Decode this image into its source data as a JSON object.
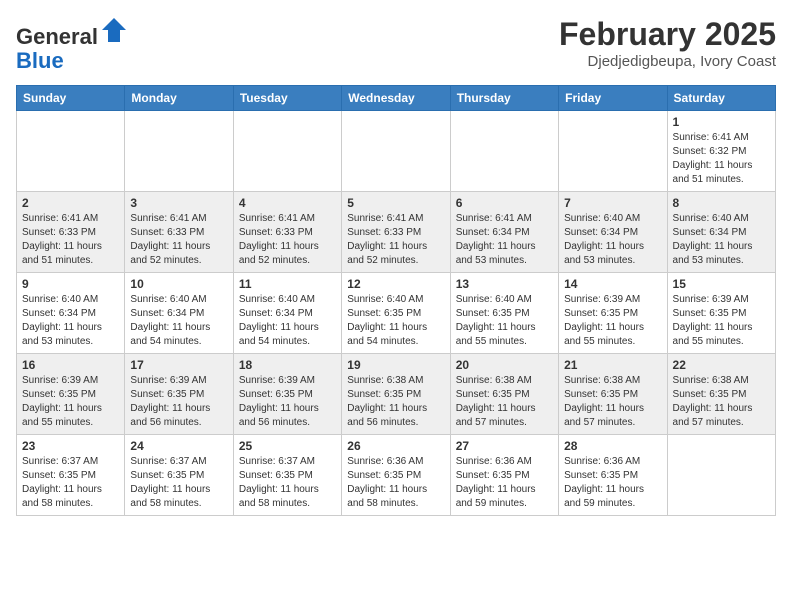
{
  "header": {
    "logo_general": "General",
    "logo_blue": "Blue",
    "month_title": "February 2025",
    "location": "Djedjedigbeupa, Ivory Coast"
  },
  "weekdays": [
    "Sunday",
    "Monday",
    "Tuesday",
    "Wednesday",
    "Thursday",
    "Friday",
    "Saturday"
  ],
  "weeks": [
    [
      {
        "day": "",
        "info": ""
      },
      {
        "day": "",
        "info": ""
      },
      {
        "day": "",
        "info": ""
      },
      {
        "day": "",
        "info": ""
      },
      {
        "day": "",
        "info": ""
      },
      {
        "day": "",
        "info": ""
      },
      {
        "day": "1",
        "info": "Sunrise: 6:41 AM\nSunset: 6:32 PM\nDaylight: 11 hours and 51 minutes."
      }
    ],
    [
      {
        "day": "2",
        "info": "Sunrise: 6:41 AM\nSunset: 6:33 PM\nDaylight: 11 hours and 51 minutes."
      },
      {
        "day": "3",
        "info": "Sunrise: 6:41 AM\nSunset: 6:33 PM\nDaylight: 11 hours and 52 minutes."
      },
      {
        "day": "4",
        "info": "Sunrise: 6:41 AM\nSunset: 6:33 PM\nDaylight: 11 hours and 52 minutes."
      },
      {
        "day": "5",
        "info": "Sunrise: 6:41 AM\nSunset: 6:33 PM\nDaylight: 11 hours and 52 minutes."
      },
      {
        "day": "6",
        "info": "Sunrise: 6:41 AM\nSunset: 6:34 PM\nDaylight: 11 hours and 53 minutes."
      },
      {
        "day": "7",
        "info": "Sunrise: 6:40 AM\nSunset: 6:34 PM\nDaylight: 11 hours and 53 minutes."
      },
      {
        "day": "8",
        "info": "Sunrise: 6:40 AM\nSunset: 6:34 PM\nDaylight: 11 hours and 53 minutes."
      }
    ],
    [
      {
        "day": "9",
        "info": "Sunrise: 6:40 AM\nSunset: 6:34 PM\nDaylight: 11 hours and 53 minutes."
      },
      {
        "day": "10",
        "info": "Sunrise: 6:40 AM\nSunset: 6:34 PM\nDaylight: 11 hours and 54 minutes."
      },
      {
        "day": "11",
        "info": "Sunrise: 6:40 AM\nSunset: 6:34 PM\nDaylight: 11 hours and 54 minutes."
      },
      {
        "day": "12",
        "info": "Sunrise: 6:40 AM\nSunset: 6:35 PM\nDaylight: 11 hours and 54 minutes."
      },
      {
        "day": "13",
        "info": "Sunrise: 6:40 AM\nSunset: 6:35 PM\nDaylight: 11 hours and 55 minutes."
      },
      {
        "day": "14",
        "info": "Sunrise: 6:39 AM\nSunset: 6:35 PM\nDaylight: 11 hours and 55 minutes."
      },
      {
        "day": "15",
        "info": "Sunrise: 6:39 AM\nSunset: 6:35 PM\nDaylight: 11 hours and 55 minutes."
      }
    ],
    [
      {
        "day": "16",
        "info": "Sunrise: 6:39 AM\nSunset: 6:35 PM\nDaylight: 11 hours and 55 minutes."
      },
      {
        "day": "17",
        "info": "Sunrise: 6:39 AM\nSunset: 6:35 PM\nDaylight: 11 hours and 56 minutes."
      },
      {
        "day": "18",
        "info": "Sunrise: 6:39 AM\nSunset: 6:35 PM\nDaylight: 11 hours and 56 minutes."
      },
      {
        "day": "19",
        "info": "Sunrise: 6:38 AM\nSunset: 6:35 PM\nDaylight: 11 hours and 56 minutes."
      },
      {
        "day": "20",
        "info": "Sunrise: 6:38 AM\nSunset: 6:35 PM\nDaylight: 11 hours and 57 minutes."
      },
      {
        "day": "21",
        "info": "Sunrise: 6:38 AM\nSunset: 6:35 PM\nDaylight: 11 hours and 57 minutes."
      },
      {
        "day": "22",
        "info": "Sunrise: 6:38 AM\nSunset: 6:35 PM\nDaylight: 11 hours and 57 minutes."
      }
    ],
    [
      {
        "day": "23",
        "info": "Sunrise: 6:37 AM\nSunset: 6:35 PM\nDaylight: 11 hours and 58 minutes."
      },
      {
        "day": "24",
        "info": "Sunrise: 6:37 AM\nSunset: 6:35 PM\nDaylight: 11 hours and 58 minutes."
      },
      {
        "day": "25",
        "info": "Sunrise: 6:37 AM\nSunset: 6:35 PM\nDaylight: 11 hours and 58 minutes."
      },
      {
        "day": "26",
        "info": "Sunrise: 6:36 AM\nSunset: 6:35 PM\nDaylight: 11 hours and 58 minutes."
      },
      {
        "day": "27",
        "info": "Sunrise: 6:36 AM\nSunset: 6:35 PM\nDaylight: 11 hours and 59 minutes."
      },
      {
        "day": "28",
        "info": "Sunrise: 6:36 AM\nSunset: 6:35 PM\nDaylight: 11 hours and 59 minutes."
      },
      {
        "day": "",
        "info": ""
      }
    ]
  ]
}
